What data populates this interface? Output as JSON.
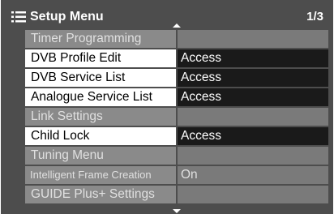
{
  "header": {
    "title": "Setup Menu",
    "page": "1/3",
    "icon": "menu-list-icon"
  },
  "rows": [
    {
      "label": "Timer Programming",
      "value": "",
      "state": "disabled"
    },
    {
      "label": "DVB Profile Edit",
      "value": "Access",
      "state": "active"
    },
    {
      "label": "DVB Service List",
      "value": "Access",
      "state": "active"
    },
    {
      "label": "Analogue Service List",
      "value": "Access",
      "state": "active"
    },
    {
      "label": "Link Settings",
      "value": "",
      "state": "disabled"
    },
    {
      "label": "Child Lock",
      "value": "Access",
      "state": "active"
    },
    {
      "label": "Tuning Menu",
      "value": "",
      "state": "disabled"
    },
    {
      "label": "Intelligent Frame Creation",
      "value": "On",
      "state": "disabled"
    },
    {
      "label": "GUIDE Plus+ Settings",
      "value": "",
      "state": "disabled"
    }
  ],
  "colors": {
    "background": "#4d4d4d",
    "active_label_bg": "#ffffff",
    "active_value_bg": "#1a1a1a",
    "disabled_label_bg": "#8a8a8a"
  }
}
